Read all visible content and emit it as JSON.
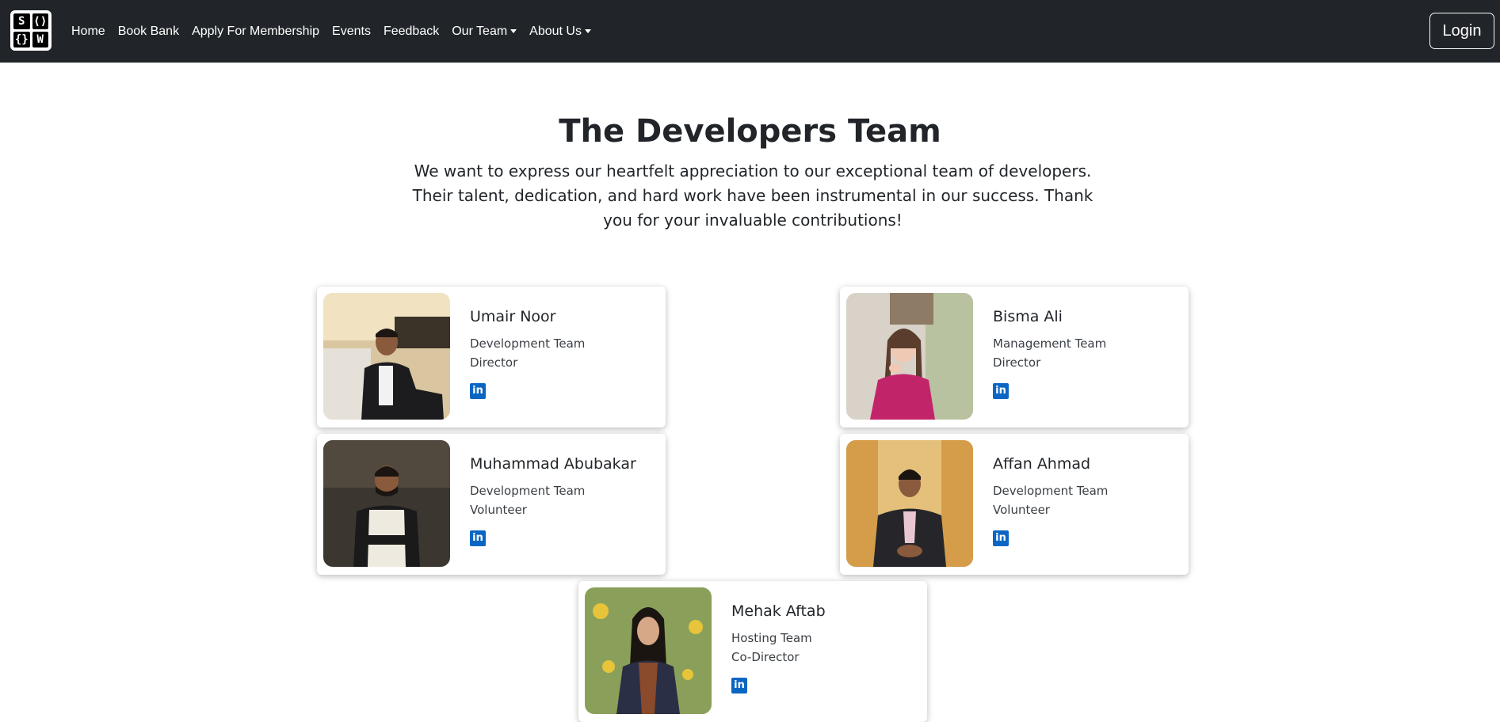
{
  "nav": {
    "logo_cells": [
      "S",
      "⟨⟩",
      "{}",
      "W"
    ],
    "items": [
      {
        "label": "Home"
      },
      {
        "label": "Book Bank"
      },
      {
        "label": "Apply For Membership"
      },
      {
        "label": "Events"
      },
      {
        "label": "Feedback"
      },
      {
        "label": "Our Team"
      },
      {
        "label": "About Us"
      }
    ],
    "login_label": "Login"
  },
  "hero": {
    "title": "The Developers Team",
    "text": "We want to express our heartfelt appreciation to our exceptional team of developers. Their talent, dedication, and hard work have been instrumental in our success. Thank you for your invaluable contributions!"
  },
  "members": [
    {
      "name": "Umair Noor",
      "team": "Development Team",
      "role": "Director"
    },
    {
      "name": "Bisma Ali",
      "team": "Management Team",
      "role": "Director"
    },
    {
      "name": "Muhammad Abubakar",
      "team": "Development Team",
      "role": "Volunteer"
    },
    {
      "name": "Affan Ahmad",
      "team": "Development Team",
      "role": "Volunteer"
    },
    {
      "name": "Mehak Aftab",
      "team": "Hosting Team",
      "role": "Co-Director"
    }
  ],
  "colors": {
    "navbar_bg": "#212529",
    "linkedin": "#0a66c2"
  },
  "icons": {
    "linkedin": "linkedin-icon",
    "dropdown": "caret-down-icon"
  }
}
